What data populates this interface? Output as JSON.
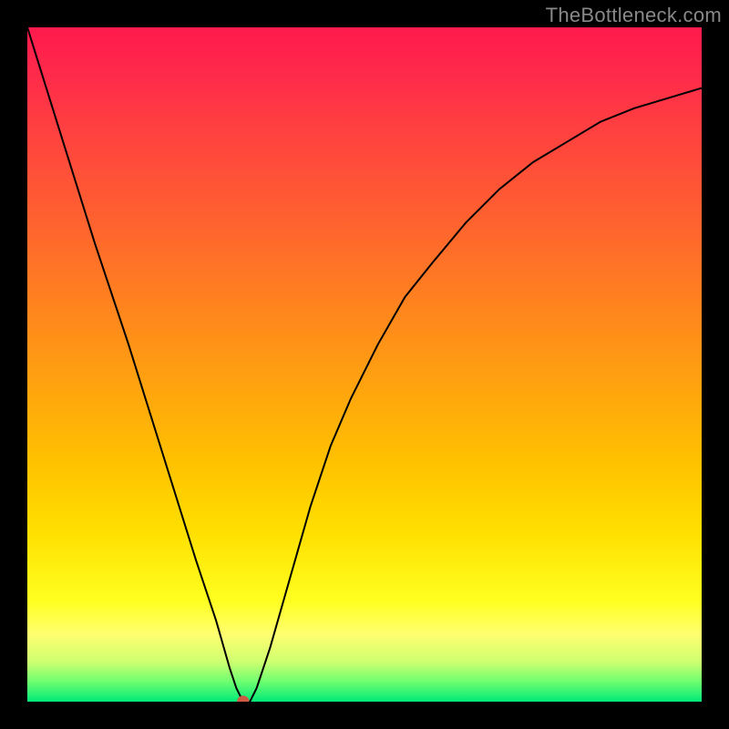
{
  "watermark": "TheBottleneck.com",
  "chart_data": {
    "type": "line",
    "title": "",
    "xlabel": "",
    "ylabel": "",
    "xlim": [
      0,
      100
    ],
    "ylim": [
      0,
      100
    ],
    "series": [
      {
        "name": "curve",
        "x": [
          0,
          5,
          10,
          15,
          20,
          25,
          28,
          30,
          31,
          32,
          33,
          34,
          36,
          38,
          40,
          42,
          45,
          48,
          52,
          56,
          60,
          65,
          70,
          75,
          80,
          85,
          90,
          95,
          100
        ],
        "y": [
          100,
          84,
          68,
          53,
          37,
          21,
          12,
          5,
          2,
          0,
          0,
          2,
          8,
          15,
          22,
          29,
          38,
          45,
          53,
          60,
          65,
          71,
          76,
          80,
          83,
          86,
          88,
          89.5,
          91
        ]
      }
    ],
    "marker": {
      "x": 32,
      "y": 0,
      "color": "#cc5a44"
    },
    "gradient_stops": [
      {
        "pos": 0,
        "color": "#ff1a4d"
      },
      {
        "pos": 15,
        "color": "#ff4040"
      },
      {
        "pos": 40,
        "color": "#ff8020"
      },
      {
        "pos": 64,
        "color": "#ffc000"
      },
      {
        "pos": 85,
        "color": "#ffff20"
      },
      {
        "pos": 100,
        "color": "#00e878"
      }
    ]
  }
}
